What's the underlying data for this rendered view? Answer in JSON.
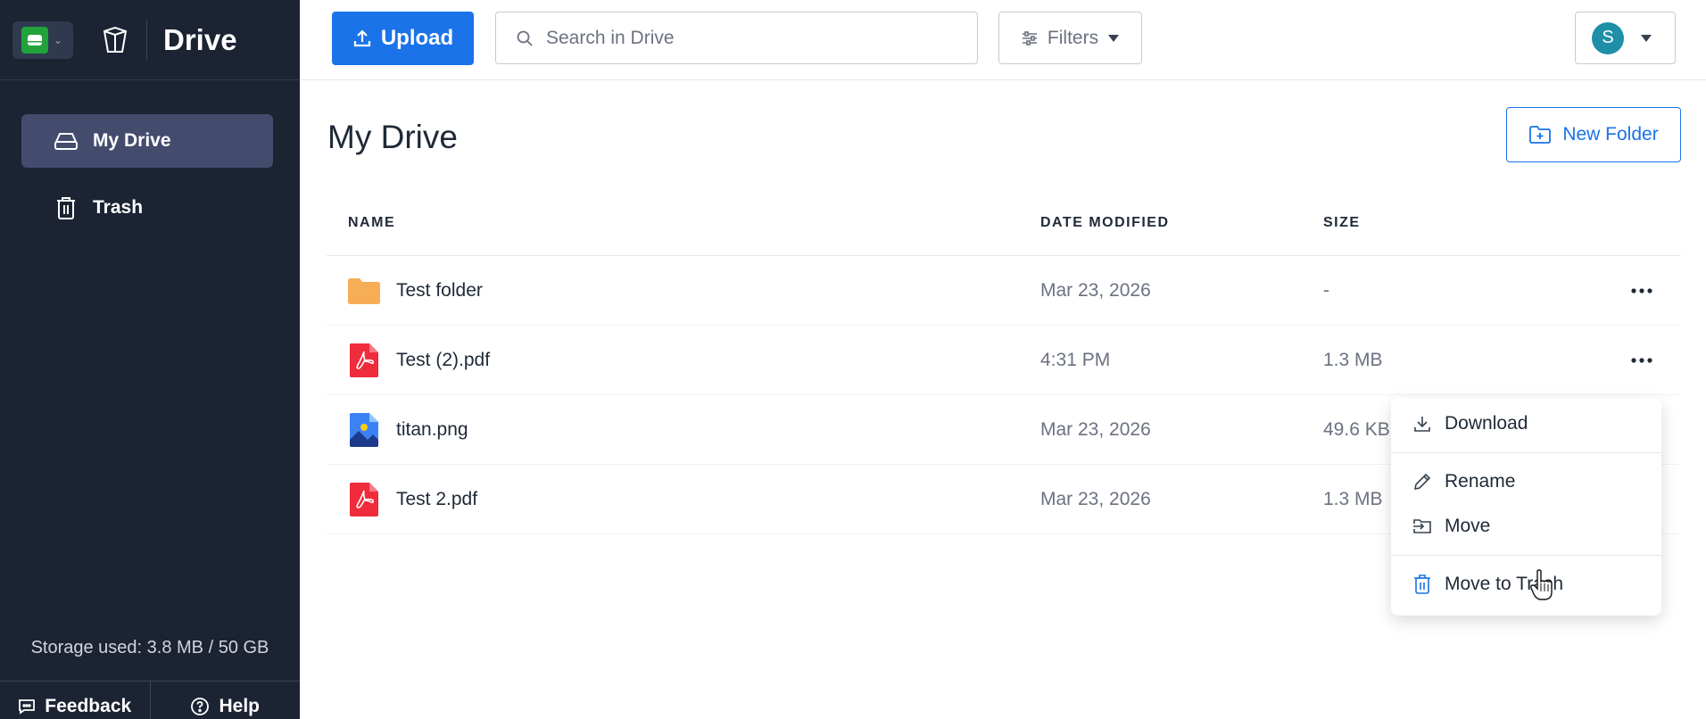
{
  "sidebar": {
    "app_title": "Drive",
    "nav": [
      {
        "label": "My Drive",
        "icon": "drive-icon",
        "active": true
      },
      {
        "label": "Trash",
        "icon": "trash-icon",
        "active": false
      }
    ],
    "storage": "Storage used: 3.8 MB / 50 GB",
    "feedback_label": "Feedback",
    "help_label": "Help"
  },
  "header": {
    "upload_label": "Upload",
    "search_placeholder": "Search in Drive",
    "filters_label": "Filters",
    "avatar_initial": "S"
  },
  "main": {
    "title": "My Drive",
    "new_folder_label": "New Folder",
    "columns": [
      "NAME",
      "DATE MODIFIED",
      "SIZE"
    ],
    "rows": [
      {
        "name": "Test folder",
        "date": "Mar 23, 2026",
        "size": "-",
        "type": "folder"
      },
      {
        "name": "Test (2).pdf",
        "date": "4:31 PM",
        "size": "1.3 MB",
        "type": "pdf"
      },
      {
        "name": "titan.png",
        "date": "Mar 23, 2026",
        "size": "49.6 KB",
        "type": "image"
      },
      {
        "name": "Test 2.pdf",
        "date": "Mar 23, 2026",
        "size": "1.3 MB",
        "type": "pdf"
      }
    ]
  },
  "context_menu": {
    "download": "Download",
    "rename": "Rename",
    "move": "Move",
    "trash": "Move to Trash"
  },
  "colors": {
    "sidebar_bg": "#1c2333",
    "accent": "#1a73e8",
    "active_nav": "#444c6e",
    "pdf_red": "#ef2b3c",
    "folder": "#f6ad55"
  }
}
